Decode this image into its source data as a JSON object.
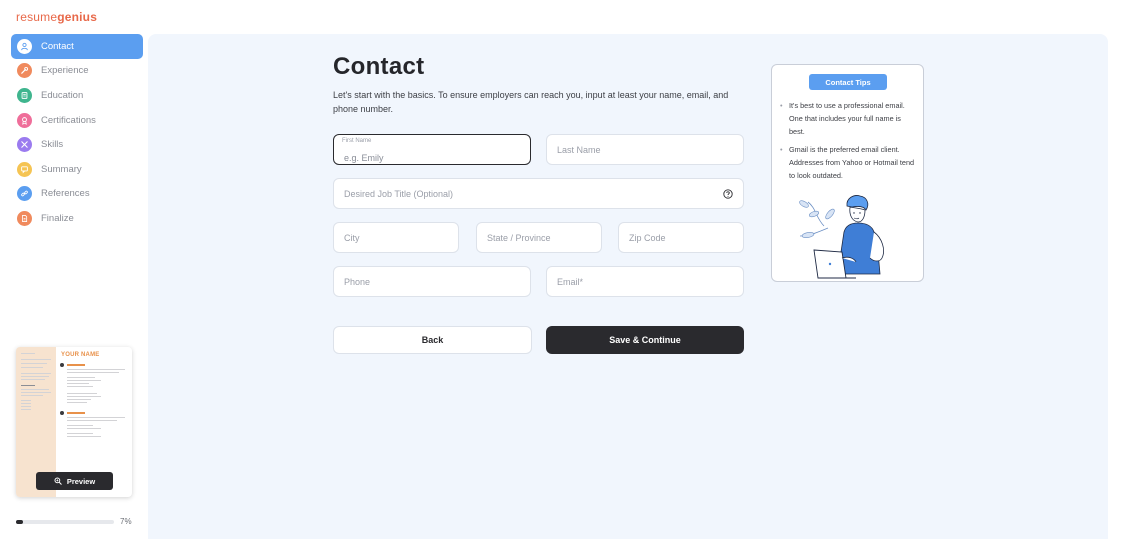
{
  "brand": {
    "part1": "resume",
    "part2": "genius"
  },
  "sidebar": {
    "items": [
      {
        "label": "Contact",
        "icon": "user-icon",
        "color": "#5b9ef0",
        "active": true
      },
      {
        "label": "Experience",
        "icon": "wrench-icon",
        "color": "#f08a5d"
      },
      {
        "label": "Education",
        "icon": "book-icon",
        "color": "#3fb58e"
      },
      {
        "label": "Certifications",
        "icon": "award-icon",
        "color": "#ef6e9a"
      },
      {
        "label": "Skills",
        "icon": "tools-icon",
        "color": "#9b7bef"
      },
      {
        "label": "Summary",
        "icon": "chat-icon",
        "color": "#f5c453"
      },
      {
        "label": "References",
        "icon": "link-icon",
        "color": "#5b9ef0"
      },
      {
        "label": "Finalize",
        "icon": "document-icon",
        "color": "#f08a5d"
      }
    ]
  },
  "preview": {
    "name_text": "YOUR NAME",
    "button_label": "Preview"
  },
  "progress": {
    "value": 0.07,
    "label": "7%"
  },
  "main": {
    "title": "Contact",
    "subtitle": "Let's start with the basics. To ensure employers can reach you, input at least your name, email, and phone number.",
    "fields": {
      "first_name_label": "First Name",
      "first_name_placeholder": "e.g. Emily",
      "last_name_placeholder": "Last Name",
      "job_title_placeholder": "Desired Job Title (Optional)",
      "city_placeholder": "City",
      "state_placeholder": "State / Province",
      "zip_placeholder": "Zip Code",
      "phone_placeholder": "Phone",
      "email_placeholder": "Email*"
    },
    "back_label": "Back",
    "save_label": "Save & Continue"
  },
  "tips": {
    "title": "Contact Tips",
    "items": [
      "It's best to use a professional email. One that includes your full name is best.",
      "Gmail is the preferred email client. Addresses from Yahoo or Hotmail tend to look outdated."
    ]
  },
  "colors": {
    "accent": "#5b9ef0",
    "brand": "#e8694a",
    "dark_button": "#2a2a2e",
    "panel_bg": "#f1f6fd"
  }
}
